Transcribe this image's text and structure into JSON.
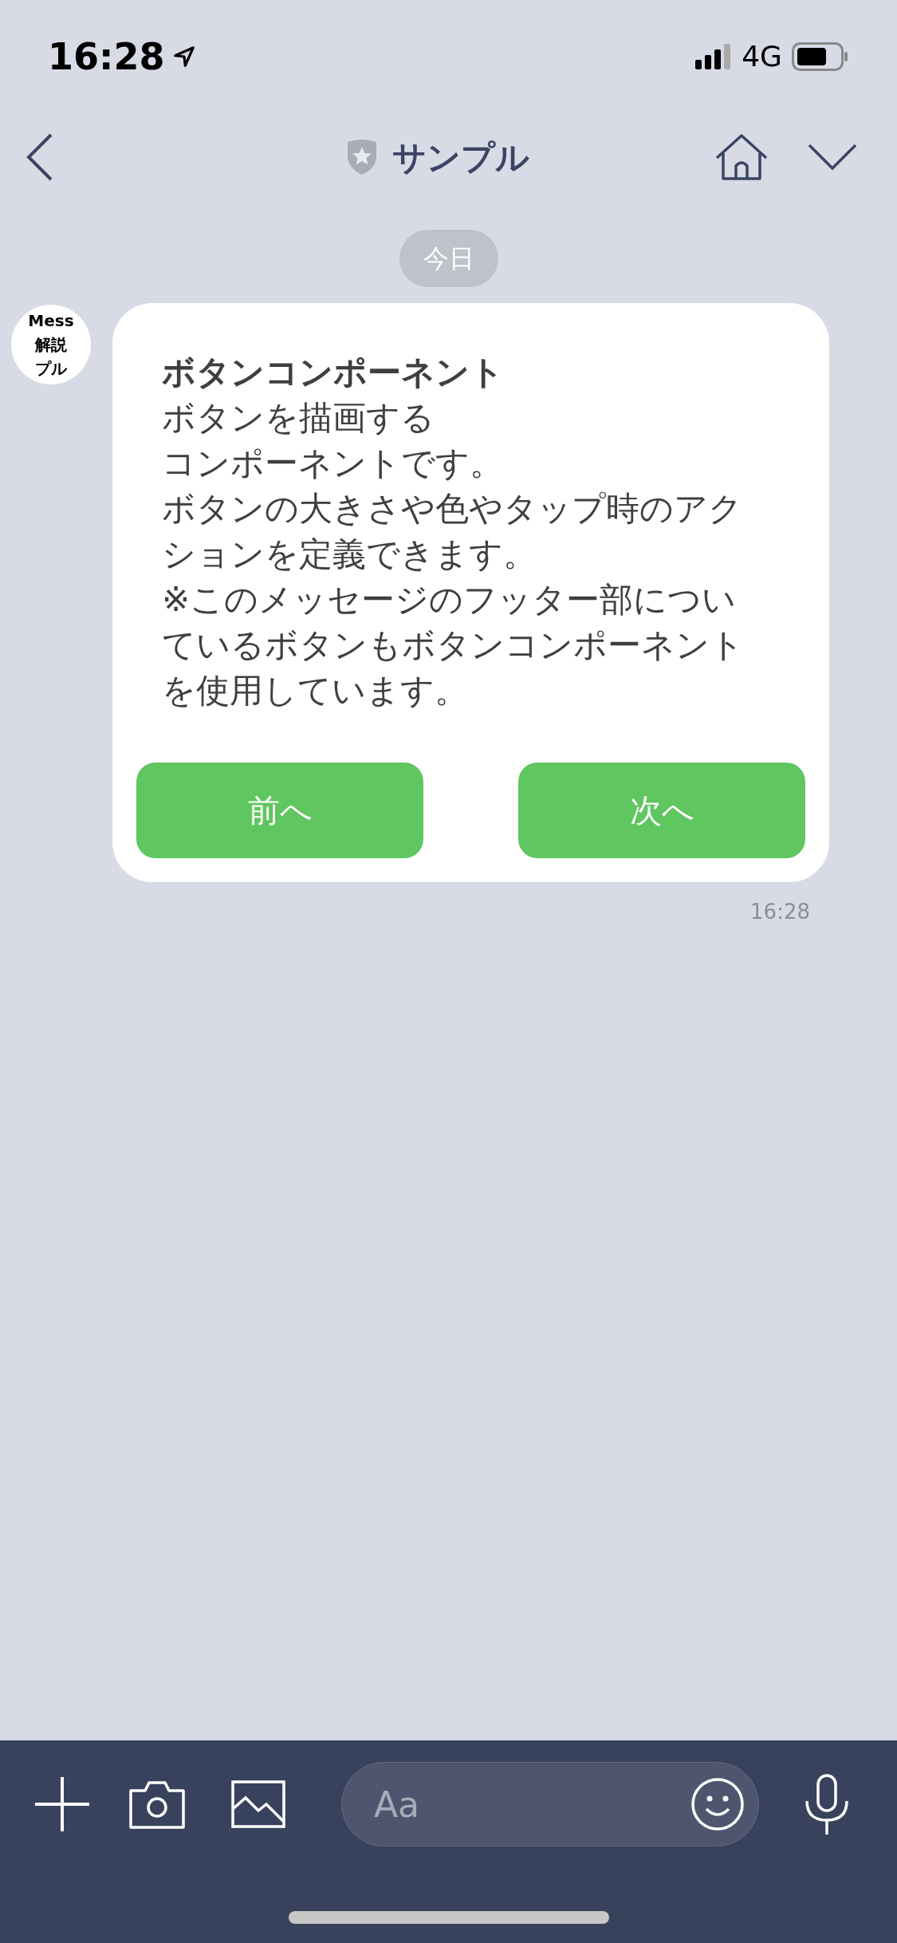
{
  "status_bar": {
    "time": "16:28",
    "network": "4G"
  },
  "header": {
    "title": "サンプル"
  },
  "date_chip": "今日",
  "avatar": {
    "lines": [
      "Mess",
      "解説",
      "プル"
    ]
  },
  "message": {
    "title": "ボタンコンポーネント",
    "paragraphs": [
      "ボタンを描画する",
      "コンポーネントです。",
      "ボタンの大きさや色やタップ時のアクションを定義できます。",
      "※このメッセージのフッター部についているボタンもボタンコンポーネントを使用しています。"
    ],
    "buttons": [
      {
        "label": "前へ"
      },
      {
        "label": "次へ"
      }
    ],
    "time": "16:28"
  },
  "composer": {
    "placeholder": "Aa"
  }
}
